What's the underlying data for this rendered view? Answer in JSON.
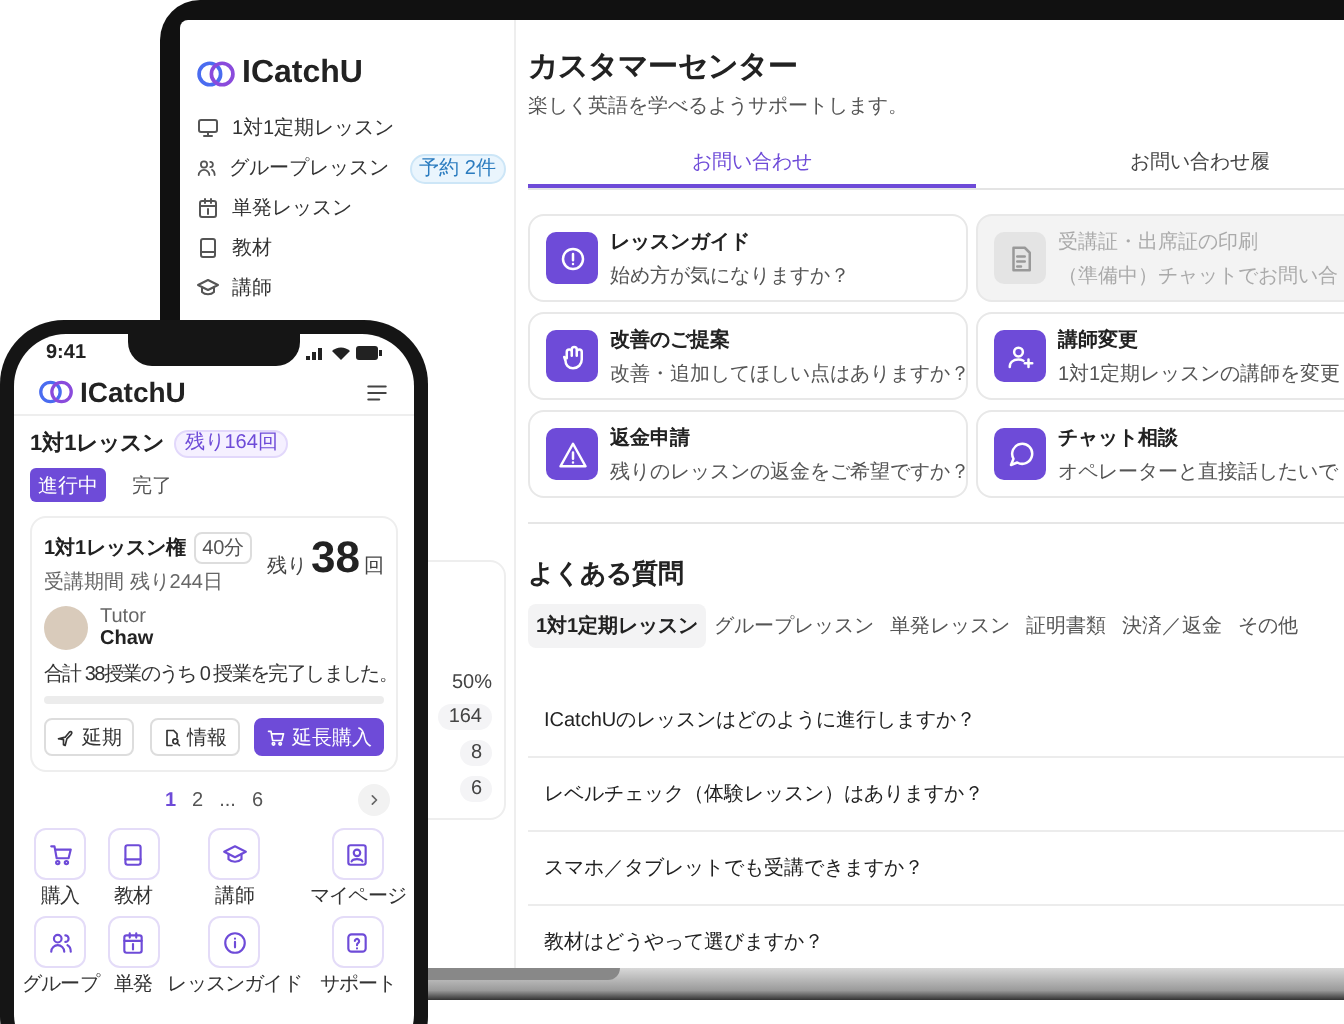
{
  "laptop": {
    "sidebar": {
      "logo": "ICatchU",
      "items": [
        {
          "label": "1対1定期レッスン"
        },
        {
          "label": "グループレッスン",
          "badge": "予約 2件"
        },
        {
          "label": "単発レッスン"
        },
        {
          "label": "教材"
        },
        {
          "label": "講師"
        }
      ],
      "card_values": [
        "50%",
        "164",
        "8",
        "6"
      ]
    },
    "main": {
      "title": "カスタマーセンター",
      "subtitle": "楽しく英語を学べるようサポートします。",
      "tabs": [
        {
          "label": "お問い合わせ",
          "selected": true
        },
        {
          "label": "お問い合わせ履",
          "selected": false
        }
      ],
      "cards": [
        {
          "title": "レッスンガイド",
          "description": "始め方が気になりますか？",
          "disabled": false
        },
        {
          "title": "受講証・出席証の印刷",
          "description": "（準備中）チャットでお問い合",
          "disabled": true
        },
        {
          "title": "改善のご提案",
          "description": "改善・追加してほしい点はありますか？",
          "disabled": false
        },
        {
          "title": "講師変更",
          "description": "1対1定期レッスンの講師を変更",
          "disabled": false
        },
        {
          "title": "返金申請",
          "description": "残りのレッスンの返金をご希望ですか？",
          "disabled": false
        },
        {
          "title": "チャット相談",
          "description": "オペレーターと直接話したいで",
          "disabled": false
        }
      ],
      "faq": {
        "title": "よくある質問",
        "tabs": [
          {
            "label": "1対1定期レッスン",
            "selected": true
          },
          {
            "label": "グループレッスン",
            "selected": false
          },
          {
            "label": "単発レッスン",
            "selected": false
          },
          {
            "label": "証明書類",
            "selected": false
          },
          {
            "label": "決済／返金",
            "selected": false
          },
          {
            "label": "その他",
            "selected": false
          }
        ],
        "questions": [
          "ICatchUのレッスンはどのように進行しますか？",
          "レベルチェック（体験レッスン）はありますか？",
          "スマホ／タブレットでも受講できますか？",
          "教材はどうやって選びますか？"
        ]
      }
    }
  },
  "phone": {
    "time": "9:41",
    "logo": "ICatchU",
    "title": "1対1レッスン",
    "title_badge": "残り164回",
    "segments": [
      {
        "label": "進行中",
        "selected": true
      },
      {
        "label": "完了",
        "selected": false
      }
    ],
    "ticket": {
      "name": "1対1レッスン権",
      "duration": "40分",
      "period": "受講期間 残り244日",
      "remaining_prefix": "残り",
      "remaining_count": "38",
      "remaining_unit": "回",
      "tutor_label": "Tutor",
      "tutor_name": "Chaw",
      "summary": "合計 38授業のうち 0 授業を完了しました。",
      "progress": {
        "level": 0
      },
      "actions": [
        {
          "label": "延期",
          "primary": false
        },
        {
          "label": "情報",
          "primary": false
        },
        {
          "label": "延長購入",
          "primary": true
        }
      ]
    },
    "pages": [
      {
        "label": "1",
        "selected": true
      },
      {
        "label": "2",
        "selected": false
      },
      {
        "label": "...",
        "selected": false
      },
      {
        "label": "6",
        "selected": false
      }
    ],
    "shortcuts": [
      {
        "label": "購入"
      },
      {
        "label": "教材"
      },
      {
        "label": "講師"
      },
      {
        "label": "マイページ"
      },
      {
        "label": "グループ"
      },
      {
        "label": "単発"
      },
      {
        "label": "レッスンガイド"
      },
      {
        "label": "サポート"
      }
    ]
  }
}
